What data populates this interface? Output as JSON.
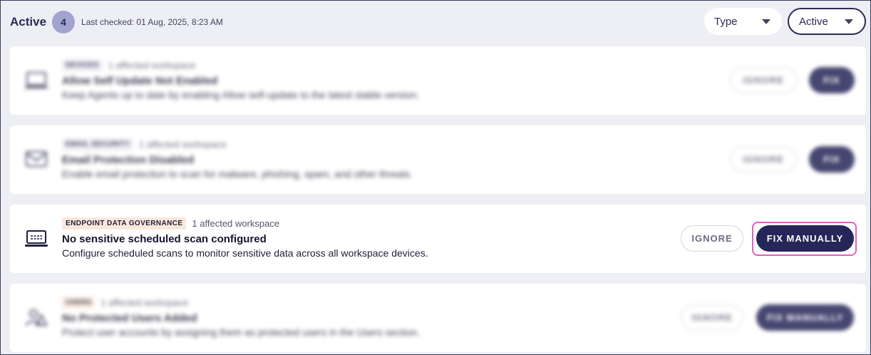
{
  "header": {
    "title": "Active",
    "count": "4",
    "last_checked": "Last checked: 01 Aug, 2025, 8:23 AM"
  },
  "filters": {
    "type_label": "Type",
    "status_label": "Active"
  },
  "cards": [
    {
      "category": "DEVICES",
      "affected": "1 affected workspace",
      "title": "Allow Self Update Not Enabled",
      "description": "Keep Agents up to date by enabling Allow self-update to the latest stable version.",
      "ignore_label": "IGNORE",
      "fix_label": "FIX",
      "icon": "laptop-icon"
    },
    {
      "category": "EMAIL SECURITY",
      "affected": "1 affected workspace",
      "title": "Email Protection Disabled",
      "description": "Enable email protection to scan for malware, phishing, spam, and other threats.",
      "ignore_label": "IGNORE",
      "fix_label": "FIX",
      "icon": "email-shield-icon"
    },
    {
      "category": "ENDPOINT DATA GOVERNANCE",
      "affected": "1 affected workspace",
      "title": "No sensitive scheduled scan configured",
      "description": "Configure scheduled scans to monitor sensitive data across all workspace devices.",
      "ignore_label": "IGNORE",
      "fix_label": "FIX MANUALLY",
      "icon": "laptop-scan-icon"
    },
    {
      "category": "USERS",
      "affected": "1 affected workspace",
      "title": "No Protected Users Added",
      "description": "Protect user accounts by assigning them as protected users in the Users section.",
      "ignore_label": "IGNORE",
      "fix_label": "FIX MANUALLY",
      "icon": "users-icon"
    }
  ],
  "colors": {
    "accent": "#262659",
    "highlight": "#e060c0",
    "background": "#eeeef5"
  }
}
